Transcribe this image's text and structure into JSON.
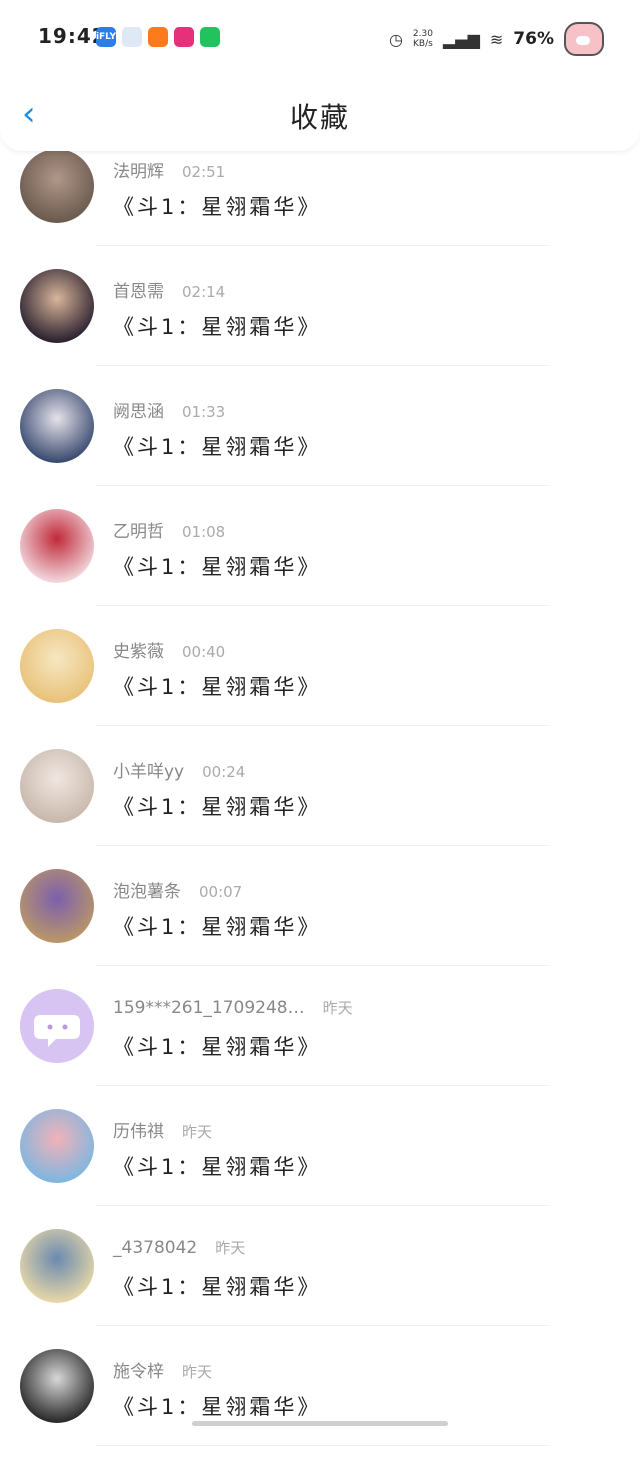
{
  "status_bar": {
    "time": "19:42",
    "net_speed": "2.30\nKB/s",
    "battery": "76%",
    "apps": [
      {
        "name": "ifly-app-icon",
        "label": "iFLY",
        "color": "#2b7de9"
      },
      {
        "name": "progress-app-icon",
        "label": "",
        "color": "#dfe8f5"
      },
      {
        "name": "orange-app-icon",
        "label": "",
        "color": "#ff7a1a"
      },
      {
        "name": "live-app-icon",
        "label": "",
        "color": "#e8307a"
      },
      {
        "name": "wechat-app-icon",
        "label": "",
        "color": "#22c35e"
      }
    ]
  },
  "header": {
    "back_icon": "chevron-left-icon",
    "title": "收藏",
    "accent": "#1e8fe6"
  },
  "items": [
    {
      "name": "法明辉",
      "time": "02:51",
      "msg": "《斗1：星翎霜华》",
      "avatar": [
        "#6b5a4e",
        "#b0978a"
      ]
    },
    {
      "name": "首恩需",
      "time": "02:14",
      "msg": "《斗1：星翎霜华》",
      "avatar": [
        "#2b2230",
        "#d8b59a"
      ]
    },
    {
      "name": "阙思涵",
      "time": "01:33",
      "msg": "《斗1：星翎霜华》",
      "avatar": [
        "#3a4b70",
        "#e6e2ea"
      ]
    },
    {
      "name": "乙明哲",
      "time": "01:08",
      "msg": "《斗1：星翎霜华》",
      "avatar": [
        "#f2d6dc",
        "#c02a3a"
      ]
    },
    {
      "name": "史紫薇",
      "time": "00:40",
      "msg": "《斗1：星翎霜华》",
      "avatar": [
        "#e9c27a",
        "#f6e7c2"
      ]
    },
    {
      "name": "小羊咩yy",
      "time": "00:24",
      "msg": "《斗1：星翎霜华》",
      "avatar": [
        "#c9b8ac",
        "#efe7e1"
      ]
    },
    {
      "name": "泡泡薯条",
      "time": "00:07",
      "msg": "《斗1：星翎霜华》",
      "avatar": [
        "#b99668",
        "#7c5fae"
      ]
    },
    {
      "name": "159***261_1709248…",
      "time": "昨天",
      "msg": "《斗1：星翎霜华》",
      "avatar": [
        "#d7c4f3",
        "#d7c4f3"
      ]
    },
    {
      "name": "历伟祺",
      "time": "昨天",
      "msg": "《斗1：星翎霜华》",
      "avatar": [
        "#7fb6e0",
        "#f2b2b8"
      ]
    },
    {
      "name": "_4378042",
      "time": "昨天",
      "msg": "《斗1：星翎霜华》",
      "avatar": [
        "#e6d6a8",
        "#6a8ab0"
      ]
    },
    {
      "name": "施令梓",
      "time": "昨天",
      "msg": "《斗1：星翎霜华》",
      "avatar": [
        "#2a2a2a",
        "#d8d8d8"
      ]
    }
  ]
}
